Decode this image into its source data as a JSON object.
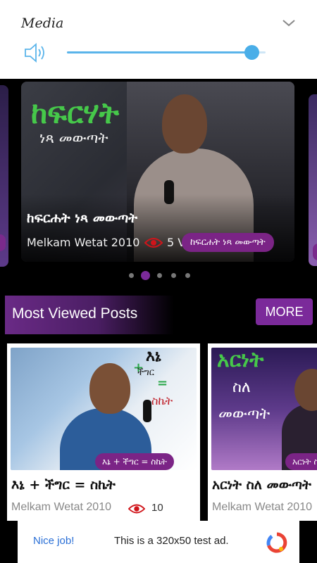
{
  "media": {
    "title": "Media",
    "volume": 0.93,
    "accent": "#4aaee8"
  },
  "carousel": {
    "slide": {
      "graphic_title": "ከፍርሃት",
      "graphic_subtitle": "ነጻ መውጣት",
      "title": "ከፍርሐት ነጻ መውጣት",
      "author": "Melkam Wetat 2010",
      "views": "5 V",
      "tag": "ከፍርሐት ነጻ መውጣት"
    },
    "dots_count": 5,
    "active_dot": 1
  },
  "section": {
    "title": "Most Viewed Posts",
    "more_label": "MORE"
  },
  "posts": [
    {
      "graphic_line1": "እኔ",
      "graphic_plus": "+",
      "graphic_line2": "ችግር",
      "graphic_eq": "=",
      "graphic_line3": "ስኬት",
      "tag": "እኔ + ችግር = ስኬት",
      "title": "እኔ + ችግር = ስኬት",
      "author": "Melkam Wetat 2010",
      "views": "10"
    },
    {
      "graphic_line1": "አርነት",
      "graphic_line2": "ስለ",
      "graphic_line3": "መውጣት",
      "tag": "አርነት ስለ መውጣት",
      "title": "አርነት ስለ መውጣት",
      "author": "Melkam Wetat 2010"
    }
  ],
  "ad": {
    "left_text": "Nice job!",
    "right_text": "This is a 320x50 test ad."
  },
  "colors": {
    "brand_purple": "#7b2a9a",
    "views_eye": "#d0141a"
  }
}
